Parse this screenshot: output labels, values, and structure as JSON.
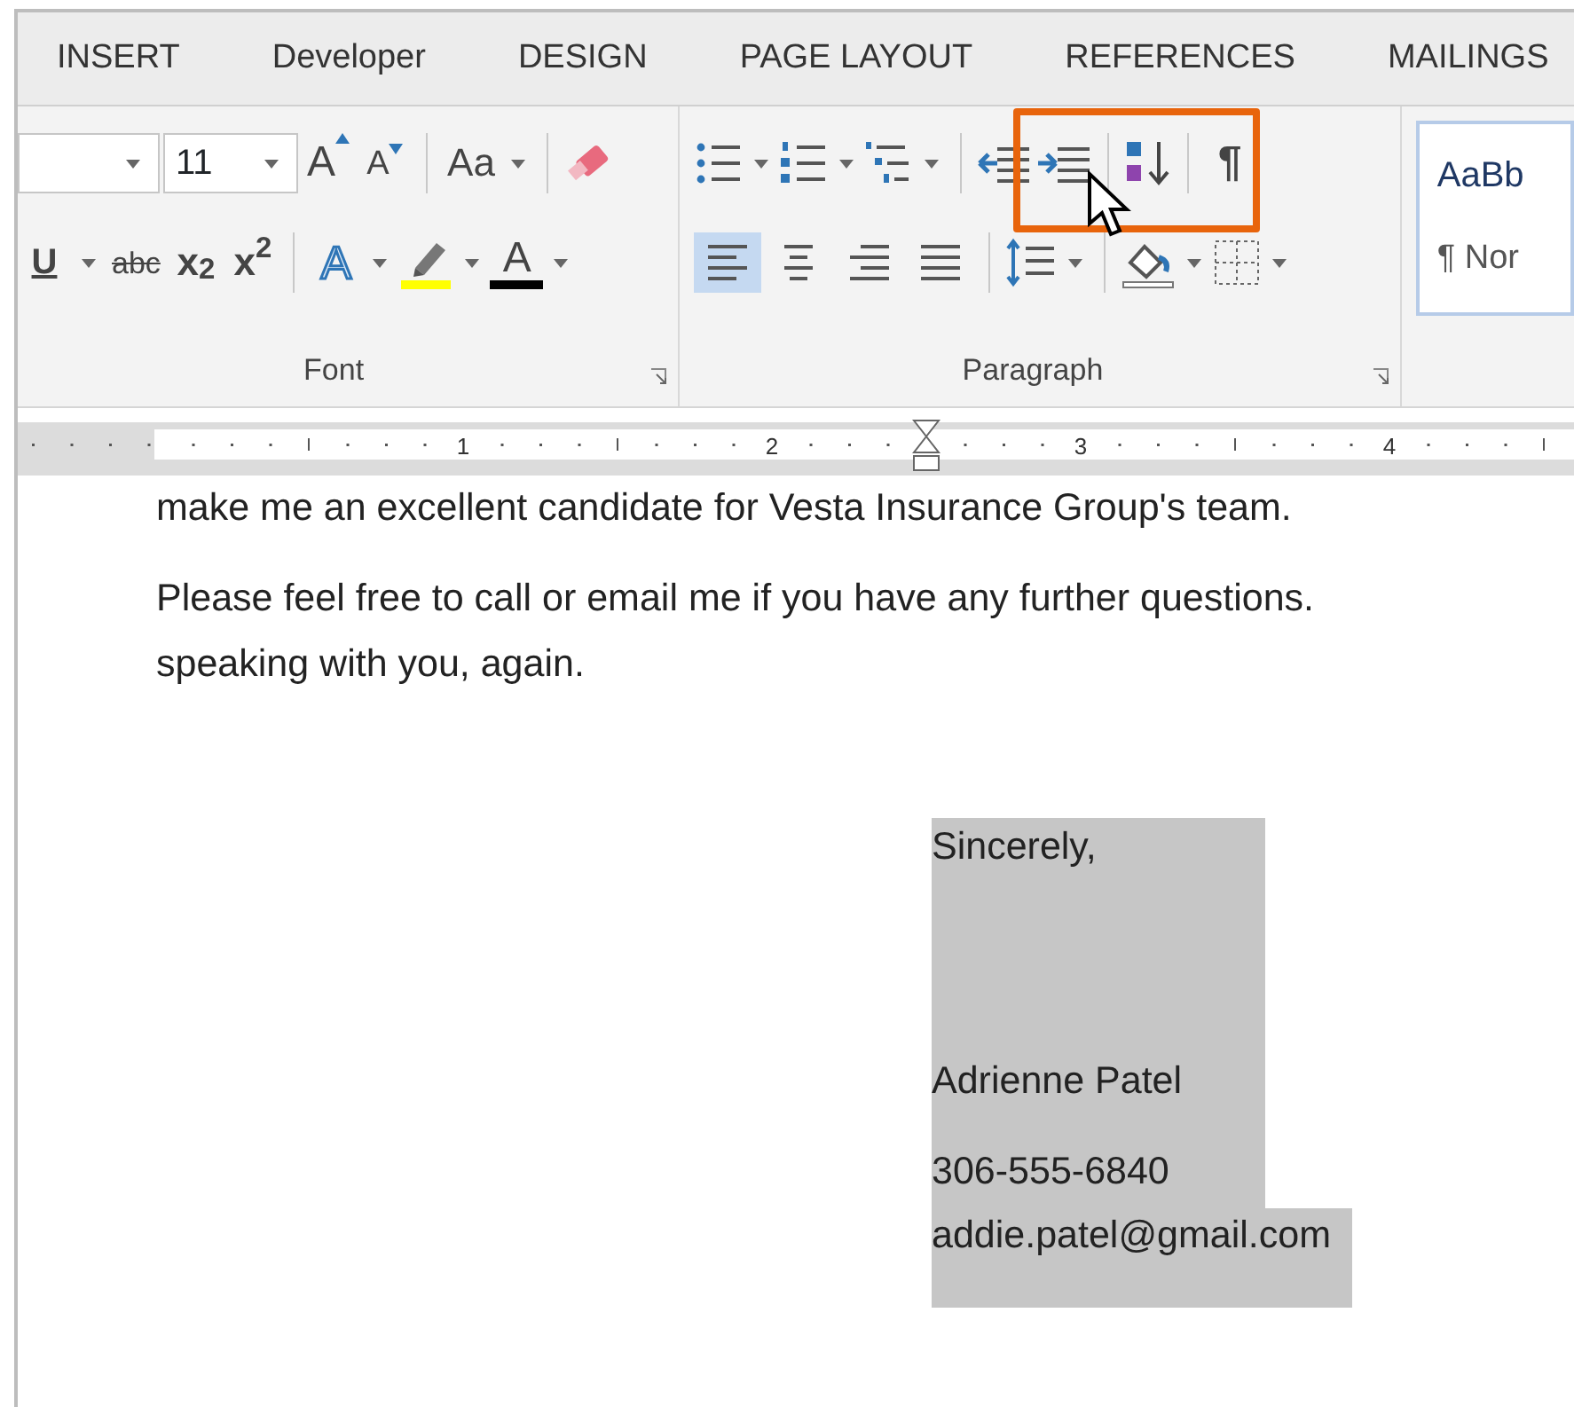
{
  "tabs": [
    {
      "label": "INSERT",
      "selected": false
    },
    {
      "label": "Developer",
      "selected": false
    },
    {
      "label": "DESIGN",
      "selected": false
    },
    {
      "label": "PAGE LAYOUT",
      "selected": false
    },
    {
      "label": "REFERENCES",
      "selected": false
    },
    {
      "label": "MAILINGS",
      "selected": false
    }
  ],
  "font_group": {
    "font_size": "11",
    "grow_font": "A",
    "shrink_font": "A",
    "change_case": "Aa",
    "underline": "U",
    "strikethrough": "abc",
    "subscript": "x$_{2}$",
    "superscript": "x$^{2}$",
    "text_effects": "A",
    "font_color": "A",
    "label": "Font"
  },
  "paragraph_group": {
    "alignments": [
      {
        "selected": true
      },
      {
        "selected": false
      },
      {
        "selected": false
      },
      {
        "selected": false
      }
    ],
    "show_marks": "¶",
    "label": "Paragraph",
    "highlighted_indent_buttons": true
  },
  "styles_group": {
    "preview": "AaBb",
    "style_name": "¶ Nor"
  },
  "ruler": {
    "numbers": [
      "1",
      "2",
      "3",
      "4"
    ]
  },
  "document": {
    "paragraphs": [
      {
        "lines": [
          "make me an excellent candidate for Vesta Insurance Group's team."
        ]
      },
      {
        "lines": [
          "Please feel free to call or email me if you have any further questions.",
          "speaking with you, again."
        ]
      }
    ],
    "signature": {
      "selected": true,
      "closing": "Sincerely,",
      "name": "Adrienne Patel",
      "phone": "306-555-6840",
      "email": "addie.patel@gmail.com"
    }
  }
}
